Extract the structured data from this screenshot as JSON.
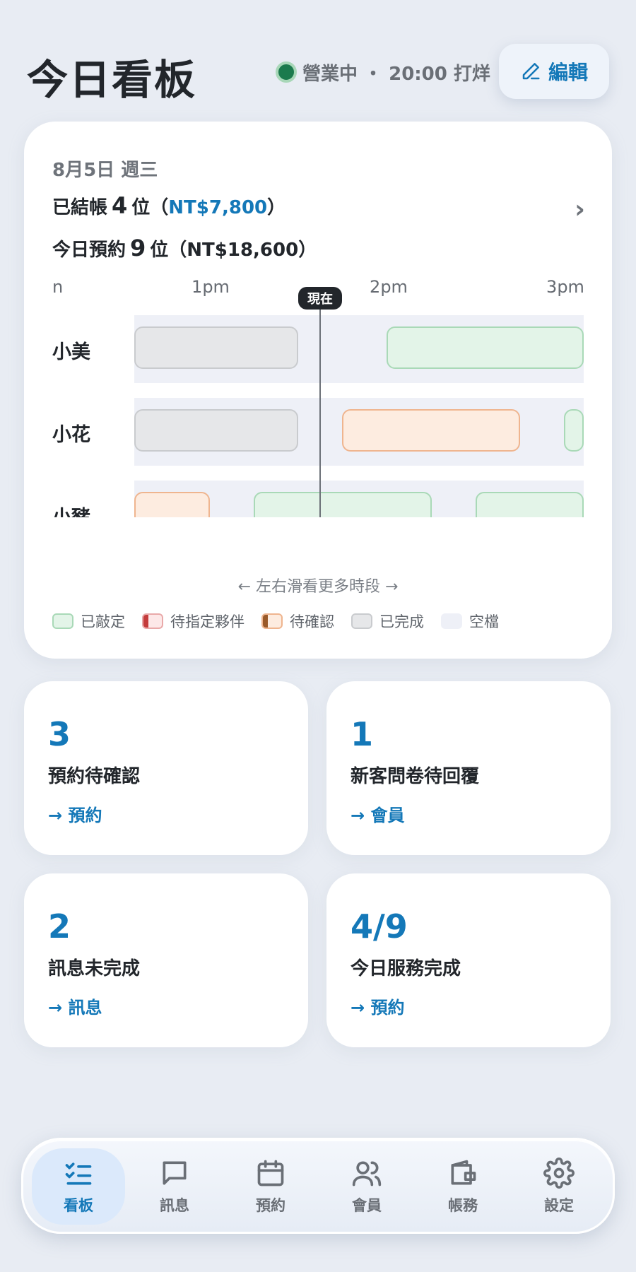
{
  "header": {
    "title": "今日看板",
    "status_text": "營業中 ・ 20:00 打烊",
    "edit_label": "編輯"
  },
  "schedule": {
    "date": "8月5日 週三",
    "checked_out": {
      "prefix": "已結帳",
      "count": "4",
      "suffix": "位（",
      "amount": "NT$7,800",
      "close": "）"
    },
    "booked_today": {
      "prefix": "今日預約",
      "count": "9",
      "suffix": "位（NT$18,600）"
    },
    "ticks": [
      "n",
      "1pm",
      "2pm",
      "3pm"
    ],
    "now_label": "現在",
    "lanes": [
      {
        "name": "小美"
      },
      {
        "name": "小花"
      },
      {
        "name": "小豬"
      }
    ],
    "scroll_hint": "← 左右滑看更多時段 →",
    "legend": [
      "已敲定",
      "待指定夥伴",
      "待確認",
      "已完成",
      "空檔"
    ]
  },
  "stats": [
    {
      "value": "3",
      "label": "預約待確認",
      "link": "→ 預約"
    },
    {
      "value": "1",
      "label": "新客問卷待回覆",
      "link": "→ 會員"
    },
    {
      "value": "2",
      "label": "訊息未完成",
      "link": "→ 訊息"
    },
    {
      "value": "4/9",
      "label": "今日服務完成",
      "link": "→ 預約"
    }
  ],
  "nav": {
    "items": [
      {
        "label": "看板",
        "icon": "checklist-icon",
        "active": true
      },
      {
        "label": "訊息",
        "icon": "chat-icon"
      },
      {
        "label": "預約",
        "icon": "calendar-icon"
      },
      {
        "label": "會員",
        "icon": "users-icon"
      },
      {
        "label": "帳務",
        "icon": "wallet-icon"
      },
      {
        "label": "設定",
        "icon": "gear-icon"
      }
    ]
  },
  "colors": {
    "accent": "#1478b8",
    "booked": "#e3f4e8",
    "pending": "#fdece0",
    "done": "#e6e7e9",
    "free": "#eef0f7"
  }
}
